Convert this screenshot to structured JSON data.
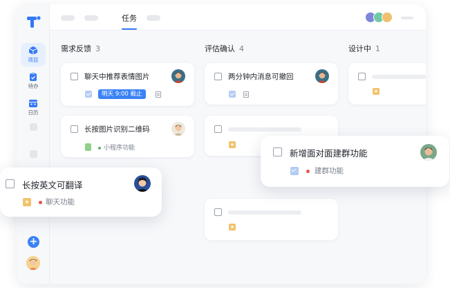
{
  "sidebar": {
    "items": [
      {
        "label": "项目",
        "icon": "cube-icon",
        "active": true
      },
      {
        "label": "待办",
        "icon": "clipboard-icon",
        "active": false
      },
      {
        "label": "日历",
        "icon": "calendar-icon",
        "active": false
      }
    ],
    "add_icon": "plus-icon"
  },
  "header": {
    "active_tab": "任务"
  },
  "columns": [
    {
      "title": "需求反馈",
      "count": "3",
      "cards": [
        {
          "title": "聊天中推荐表情图片",
          "due": "明天 9:00 截止"
        },
        {
          "title": "长按图片识别二维码",
          "tag": "小程序功能"
        }
      ]
    },
    {
      "title": "评估确认",
      "count": "4",
      "cards": [
        {
          "title": "两分钟内消息可撤回"
        }
      ]
    },
    {
      "title": "设计中",
      "count": "1"
    }
  ],
  "floating_cards": [
    {
      "title": "新增面对面建群功能",
      "tag": "建群功能"
    },
    {
      "title": "长按英文可翻译",
      "tag": "聊天功能"
    }
  ],
  "colors": {
    "accent": "#3478f6",
    "tag_red": "#e5534b",
    "tag_green": "#5ab66a",
    "star": "#f2c26b"
  }
}
